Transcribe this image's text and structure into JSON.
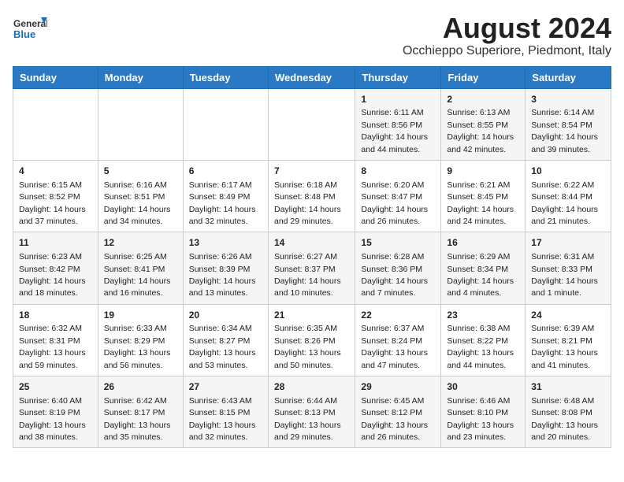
{
  "logo": {
    "line1": "General",
    "line2": "Blue"
  },
  "title": "August 2024",
  "location": "Occhieppo Superiore, Piedmont, Italy",
  "weekdays": [
    "Sunday",
    "Monday",
    "Tuesday",
    "Wednesday",
    "Thursday",
    "Friday",
    "Saturday"
  ],
  "weeks": [
    [
      {
        "day": "",
        "info": ""
      },
      {
        "day": "",
        "info": ""
      },
      {
        "day": "",
        "info": ""
      },
      {
        "day": "",
        "info": ""
      },
      {
        "day": "1",
        "info": "Sunrise: 6:11 AM\nSunset: 8:56 PM\nDaylight: 14 hours and 44 minutes."
      },
      {
        "day": "2",
        "info": "Sunrise: 6:13 AM\nSunset: 8:55 PM\nDaylight: 14 hours and 42 minutes."
      },
      {
        "day": "3",
        "info": "Sunrise: 6:14 AM\nSunset: 8:54 PM\nDaylight: 14 hours and 39 minutes."
      }
    ],
    [
      {
        "day": "4",
        "info": "Sunrise: 6:15 AM\nSunset: 8:52 PM\nDaylight: 14 hours and 37 minutes."
      },
      {
        "day": "5",
        "info": "Sunrise: 6:16 AM\nSunset: 8:51 PM\nDaylight: 14 hours and 34 minutes."
      },
      {
        "day": "6",
        "info": "Sunrise: 6:17 AM\nSunset: 8:49 PM\nDaylight: 14 hours and 32 minutes."
      },
      {
        "day": "7",
        "info": "Sunrise: 6:18 AM\nSunset: 8:48 PM\nDaylight: 14 hours and 29 minutes."
      },
      {
        "day": "8",
        "info": "Sunrise: 6:20 AM\nSunset: 8:47 PM\nDaylight: 14 hours and 26 minutes."
      },
      {
        "day": "9",
        "info": "Sunrise: 6:21 AM\nSunset: 8:45 PM\nDaylight: 14 hours and 24 minutes."
      },
      {
        "day": "10",
        "info": "Sunrise: 6:22 AM\nSunset: 8:44 PM\nDaylight: 14 hours and 21 minutes."
      }
    ],
    [
      {
        "day": "11",
        "info": "Sunrise: 6:23 AM\nSunset: 8:42 PM\nDaylight: 14 hours and 18 minutes."
      },
      {
        "day": "12",
        "info": "Sunrise: 6:25 AM\nSunset: 8:41 PM\nDaylight: 14 hours and 16 minutes."
      },
      {
        "day": "13",
        "info": "Sunrise: 6:26 AM\nSunset: 8:39 PM\nDaylight: 14 hours and 13 minutes."
      },
      {
        "day": "14",
        "info": "Sunrise: 6:27 AM\nSunset: 8:37 PM\nDaylight: 14 hours and 10 minutes."
      },
      {
        "day": "15",
        "info": "Sunrise: 6:28 AM\nSunset: 8:36 PM\nDaylight: 14 hours and 7 minutes."
      },
      {
        "day": "16",
        "info": "Sunrise: 6:29 AM\nSunset: 8:34 PM\nDaylight: 14 hours and 4 minutes."
      },
      {
        "day": "17",
        "info": "Sunrise: 6:31 AM\nSunset: 8:33 PM\nDaylight: 14 hours and 1 minute."
      }
    ],
    [
      {
        "day": "18",
        "info": "Sunrise: 6:32 AM\nSunset: 8:31 PM\nDaylight: 13 hours and 59 minutes."
      },
      {
        "day": "19",
        "info": "Sunrise: 6:33 AM\nSunset: 8:29 PM\nDaylight: 13 hours and 56 minutes."
      },
      {
        "day": "20",
        "info": "Sunrise: 6:34 AM\nSunset: 8:27 PM\nDaylight: 13 hours and 53 minutes."
      },
      {
        "day": "21",
        "info": "Sunrise: 6:35 AM\nSunset: 8:26 PM\nDaylight: 13 hours and 50 minutes."
      },
      {
        "day": "22",
        "info": "Sunrise: 6:37 AM\nSunset: 8:24 PM\nDaylight: 13 hours and 47 minutes."
      },
      {
        "day": "23",
        "info": "Sunrise: 6:38 AM\nSunset: 8:22 PM\nDaylight: 13 hours and 44 minutes."
      },
      {
        "day": "24",
        "info": "Sunrise: 6:39 AM\nSunset: 8:21 PM\nDaylight: 13 hours and 41 minutes."
      }
    ],
    [
      {
        "day": "25",
        "info": "Sunrise: 6:40 AM\nSunset: 8:19 PM\nDaylight: 13 hours and 38 minutes."
      },
      {
        "day": "26",
        "info": "Sunrise: 6:42 AM\nSunset: 8:17 PM\nDaylight: 13 hours and 35 minutes."
      },
      {
        "day": "27",
        "info": "Sunrise: 6:43 AM\nSunset: 8:15 PM\nDaylight: 13 hours and 32 minutes."
      },
      {
        "day": "28",
        "info": "Sunrise: 6:44 AM\nSunset: 8:13 PM\nDaylight: 13 hours and 29 minutes."
      },
      {
        "day": "29",
        "info": "Sunrise: 6:45 AM\nSunset: 8:12 PM\nDaylight: 13 hours and 26 minutes."
      },
      {
        "day": "30",
        "info": "Sunrise: 6:46 AM\nSunset: 8:10 PM\nDaylight: 13 hours and 23 minutes."
      },
      {
        "day": "31",
        "info": "Sunrise: 6:48 AM\nSunset: 8:08 PM\nDaylight: 13 hours and 20 minutes."
      }
    ]
  ]
}
